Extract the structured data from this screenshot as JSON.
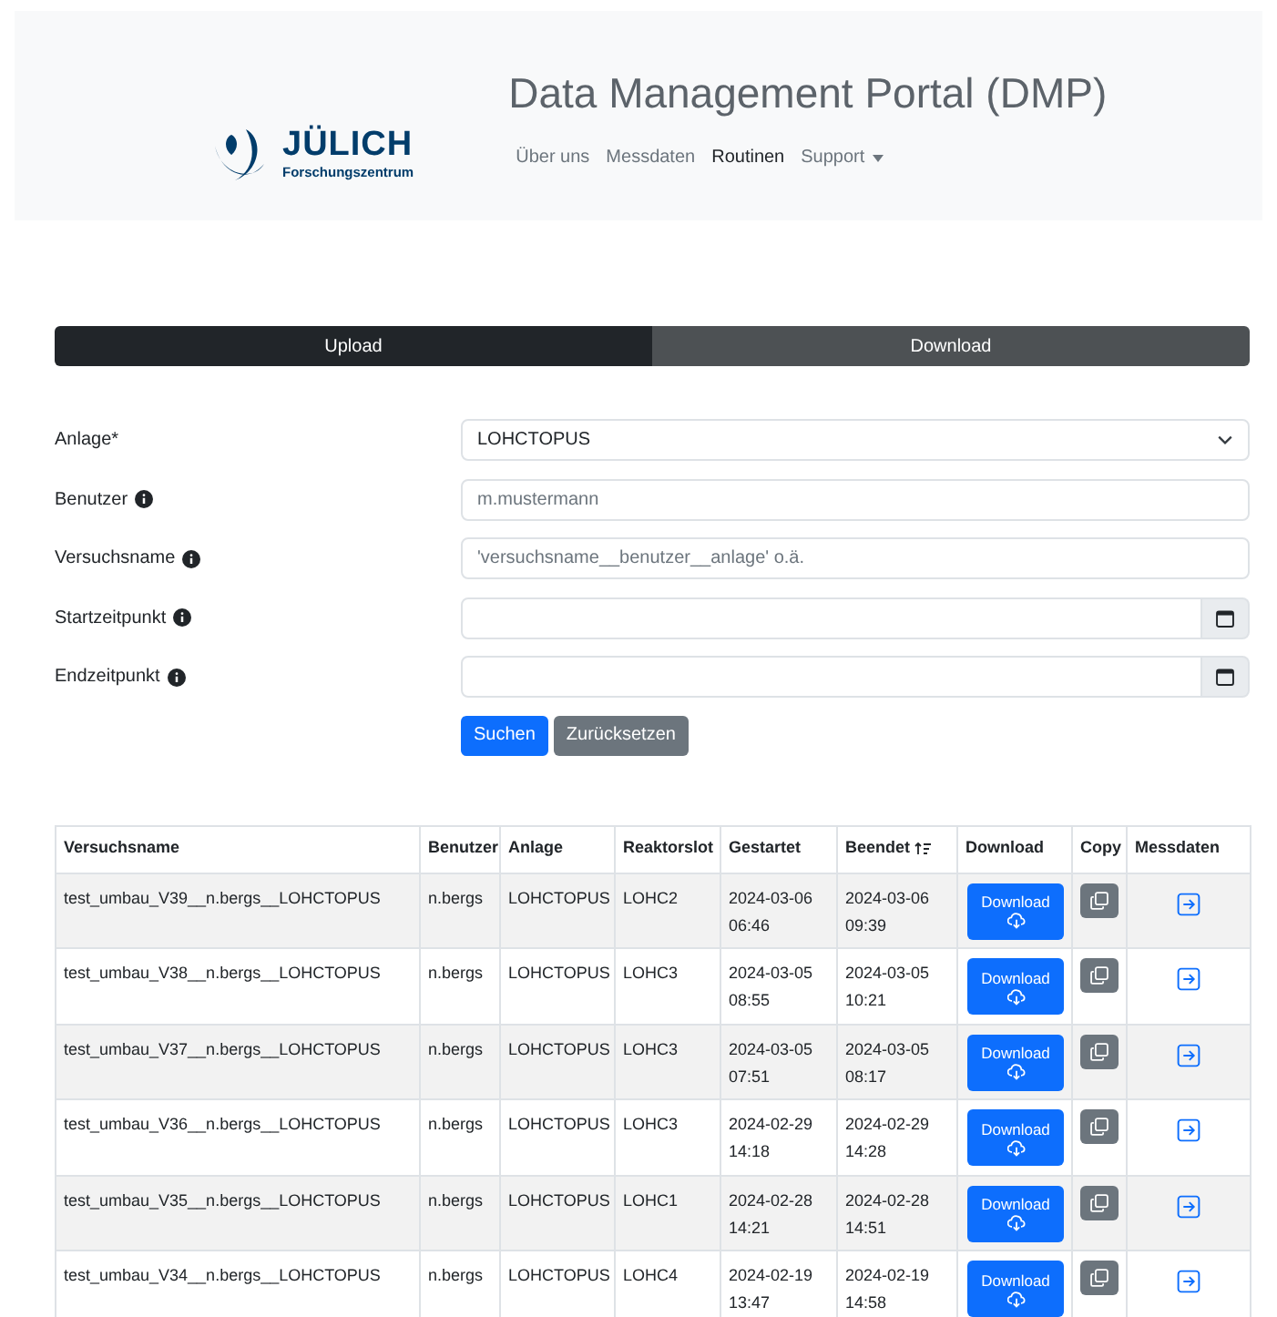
{
  "header": {
    "logo": {
      "name": "JÜLICH",
      "subtitle": "Forschungszentrum"
    },
    "title": "Data Management Portal (DMP)",
    "nav": [
      {
        "label": "Über uns",
        "selected": false,
        "dropdown": false
      },
      {
        "label": "Messdaten",
        "selected": false,
        "dropdown": false
      },
      {
        "label": "Routinen",
        "selected": true,
        "dropdown": false
      },
      {
        "label": "Support",
        "selected": false,
        "dropdown": true
      }
    ]
  },
  "tabs": [
    {
      "label": "Upload",
      "selected": true
    },
    {
      "label": "Download",
      "selected": false
    }
  ],
  "form": {
    "fields": [
      {
        "kind": "select",
        "label": "Anlage*",
        "info": false,
        "value": "LOHCTOPUS"
      },
      {
        "kind": "text",
        "label": "Benutzer",
        "info": true,
        "placeholder": "m.mustermann"
      },
      {
        "kind": "text",
        "label": "Versuchsname",
        "info": true,
        "placeholder": "'versuchsname__benutzer__anlage' o.ä."
      },
      {
        "kind": "date",
        "label": "Startzeitpunkt",
        "info": true
      },
      {
        "kind": "date",
        "label": "Endzeitpunkt",
        "info": true
      }
    ],
    "buttons": [
      {
        "label": "Suchen",
        "kind": "primary"
      },
      {
        "label": "Zurücksetzen",
        "kind": "secondary"
      }
    ]
  },
  "table": {
    "columns": [
      {
        "label": "Versuchsname",
        "sorted": false
      },
      {
        "label": "Benutzer",
        "sorted": false
      },
      {
        "label": "Anlage",
        "sorted": false
      },
      {
        "label": "Reaktorslot",
        "sorted": false
      },
      {
        "label": "Gestartet",
        "sorted": false
      },
      {
        "label": "Beendet",
        "sorted": true
      },
      {
        "label": "Download",
        "sorted": false
      },
      {
        "label": "Copy",
        "sorted": false
      },
      {
        "label": "Messdaten",
        "sorted": false
      }
    ],
    "rows": [
      {
        "name": "test_umbau_V39__n.bergs__LOHCTOPUS",
        "user": "n.bergs",
        "plant": "LOHCTOPUS",
        "slot": "LOHC2",
        "start": [
          "2024-03-06",
          "06:46"
        ],
        "end": [
          "2024-03-06",
          "09:39"
        ],
        "download": "Download"
      },
      {
        "name": "test_umbau_V38__n.bergs__LOHCTOPUS",
        "user": "n.bergs",
        "plant": "LOHCTOPUS",
        "slot": "LOHC3",
        "start": [
          "2024-03-05",
          "08:55"
        ],
        "end": [
          "2024-03-05",
          "10:21"
        ],
        "download": "Download"
      },
      {
        "name": "test_umbau_V37__n.bergs__LOHCTOPUS",
        "user": "n.bergs",
        "plant": "LOHCTOPUS",
        "slot": "LOHC3",
        "start": [
          "2024-03-05",
          "07:51"
        ],
        "end": [
          "2024-03-05",
          "08:17"
        ],
        "download": "Download"
      },
      {
        "name": "test_umbau_V36__n.bergs__LOHCTOPUS",
        "user": "n.bergs",
        "plant": "LOHCTOPUS",
        "slot": "LOHC3",
        "start": [
          "2024-02-29",
          "14:18"
        ],
        "end": [
          "2024-02-29",
          "14:28"
        ],
        "download": "Download"
      },
      {
        "name": "test_umbau_V35__n.bergs__LOHCTOPUS",
        "user": "n.bergs",
        "plant": "LOHCTOPUS",
        "slot": "LOHC1",
        "start": [
          "2024-02-28",
          "14:21"
        ],
        "end": [
          "2024-02-28",
          "14:51"
        ],
        "download": "Download"
      },
      {
        "name": "test_umbau_V34__n.bergs__LOHCTOPUS",
        "user": "n.bergs",
        "plant": "LOHCTOPUS",
        "slot": "LOHC4",
        "start": [
          "2024-02-19",
          "13:47"
        ],
        "end": [
          "2024-02-19",
          "14:58"
        ],
        "download": "Download"
      }
    ]
  }
}
